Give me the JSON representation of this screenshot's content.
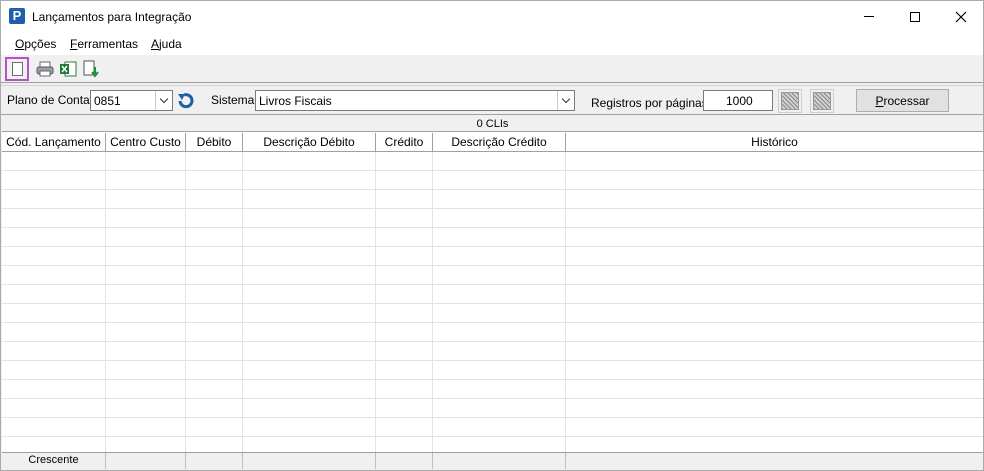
{
  "window": {
    "title": "Lançamentos para Integração",
    "app_icon_letter": "P"
  },
  "menu": [
    "Opções",
    "Ferramentas",
    "Ajuda"
  ],
  "toolbar": {
    "icons": [
      "new-document-icon",
      "print-icon",
      "excel-export-icon",
      "import-icon"
    ]
  },
  "filters": {
    "plano_label": "Plano de Contas",
    "plano_value": "0851",
    "sistema_label": "Sistema",
    "sistema_value": "Livros Fiscais",
    "registros_label": "Registros por páginas:",
    "registros_value": "1000",
    "processar_label": "Processar"
  },
  "grid": {
    "count_label": "0 CLIs",
    "columns": [
      "Cód. Lançamento",
      "Centro Custo",
      "Débito",
      "Descrição Débito",
      "Crédito",
      "Descrição Crédito",
      "Histórico"
    ],
    "footer": [
      "Crescente",
      "",
      "",
      "",
      "",
      "",
      ""
    ]
  },
  "colors": {
    "selection_border": "#b453c4",
    "app_icon": "#1f5fa8"
  }
}
